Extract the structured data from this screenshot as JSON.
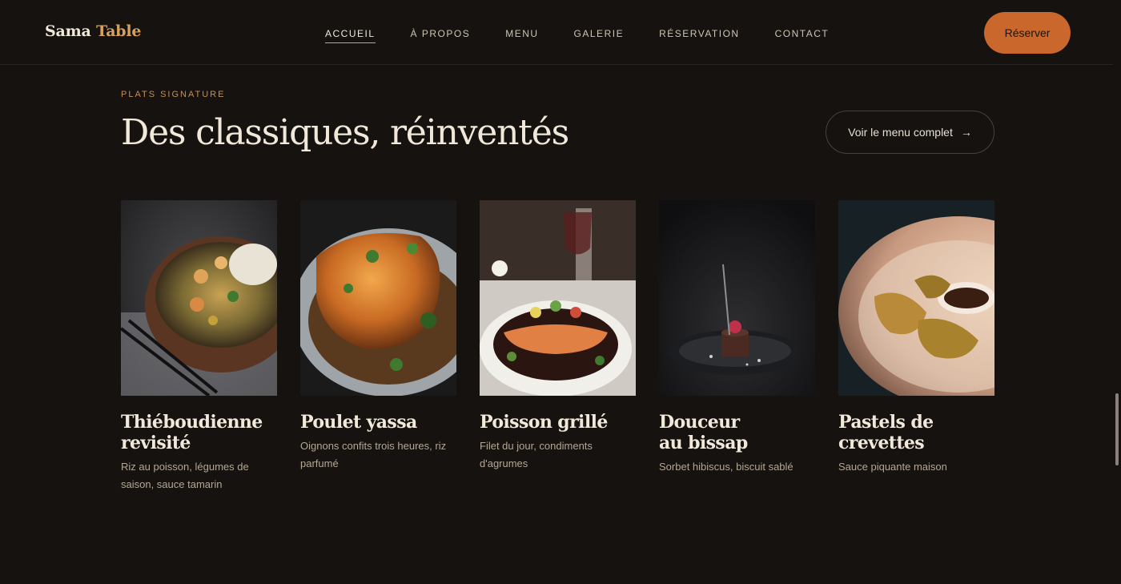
{
  "brand": {
    "part1": "Sama",
    "part2": "Table"
  },
  "nav": {
    "items": [
      {
        "label": "ACCUEIL",
        "active": true
      },
      {
        "label": "À PROPOS",
        "active": false
      },
      {
        "label": "MENU",
        "active": false
      },
      {
        "label": "GALERIE",
        "active": false
      },
      {
        "label": "RÉSERVATION",
        "active": false
      },
      {
        "label": "CONTACT",
        "active": false
      }
    ],
    "cta_label": "Réserver"
  },
  "section": {
    "eyebrow": "PLATS SIGNATURE",
    "title": "Des classiques, réinventés",
    "menu_button_label": "Voir le menu complet",
    "menu_button_arrow": "→"
  },
  "dishes": [
    {
      "name_line1": "Thiéboudienne",
      "name_line2": "revisité",
      "description": "Riz au poisson, légumes de saison, sauce tamarin",
      "image": "rice-bowl-photo"
    },
    {
      "name_line1": "Poulet yassa",
      "name_line2": "",
      "description": "Oignons confits trois heures, riz parfumé",
      "image": "roast-chicken-photo"
    },
    {
      "name_line1": "Poisson grillé",
      "name_line2": "",
      "description": "Filet du jour, condiments d'agrumes",
      "image": "grilled-fish-photo"
    },
    {
      "name_line1": "Douceur",
      "name_line2": "au bissap",
      "description": "Sorbet hibiscus, biscuit sablé",
      "image": "dessert-photo"
    },
    {
      "name_line1": "Pastels de",
      "name_line2": "crevettes",
      "description": "Sauce piquante maison",
      "image": "shrimp-pastels-photo"
    }
  ],
  "colors": {
    "background": "#15120f",
    "accent": "#c9672c",
    "gold": "#d6a35e",
    "text": "#f1e8da"
  }
}
